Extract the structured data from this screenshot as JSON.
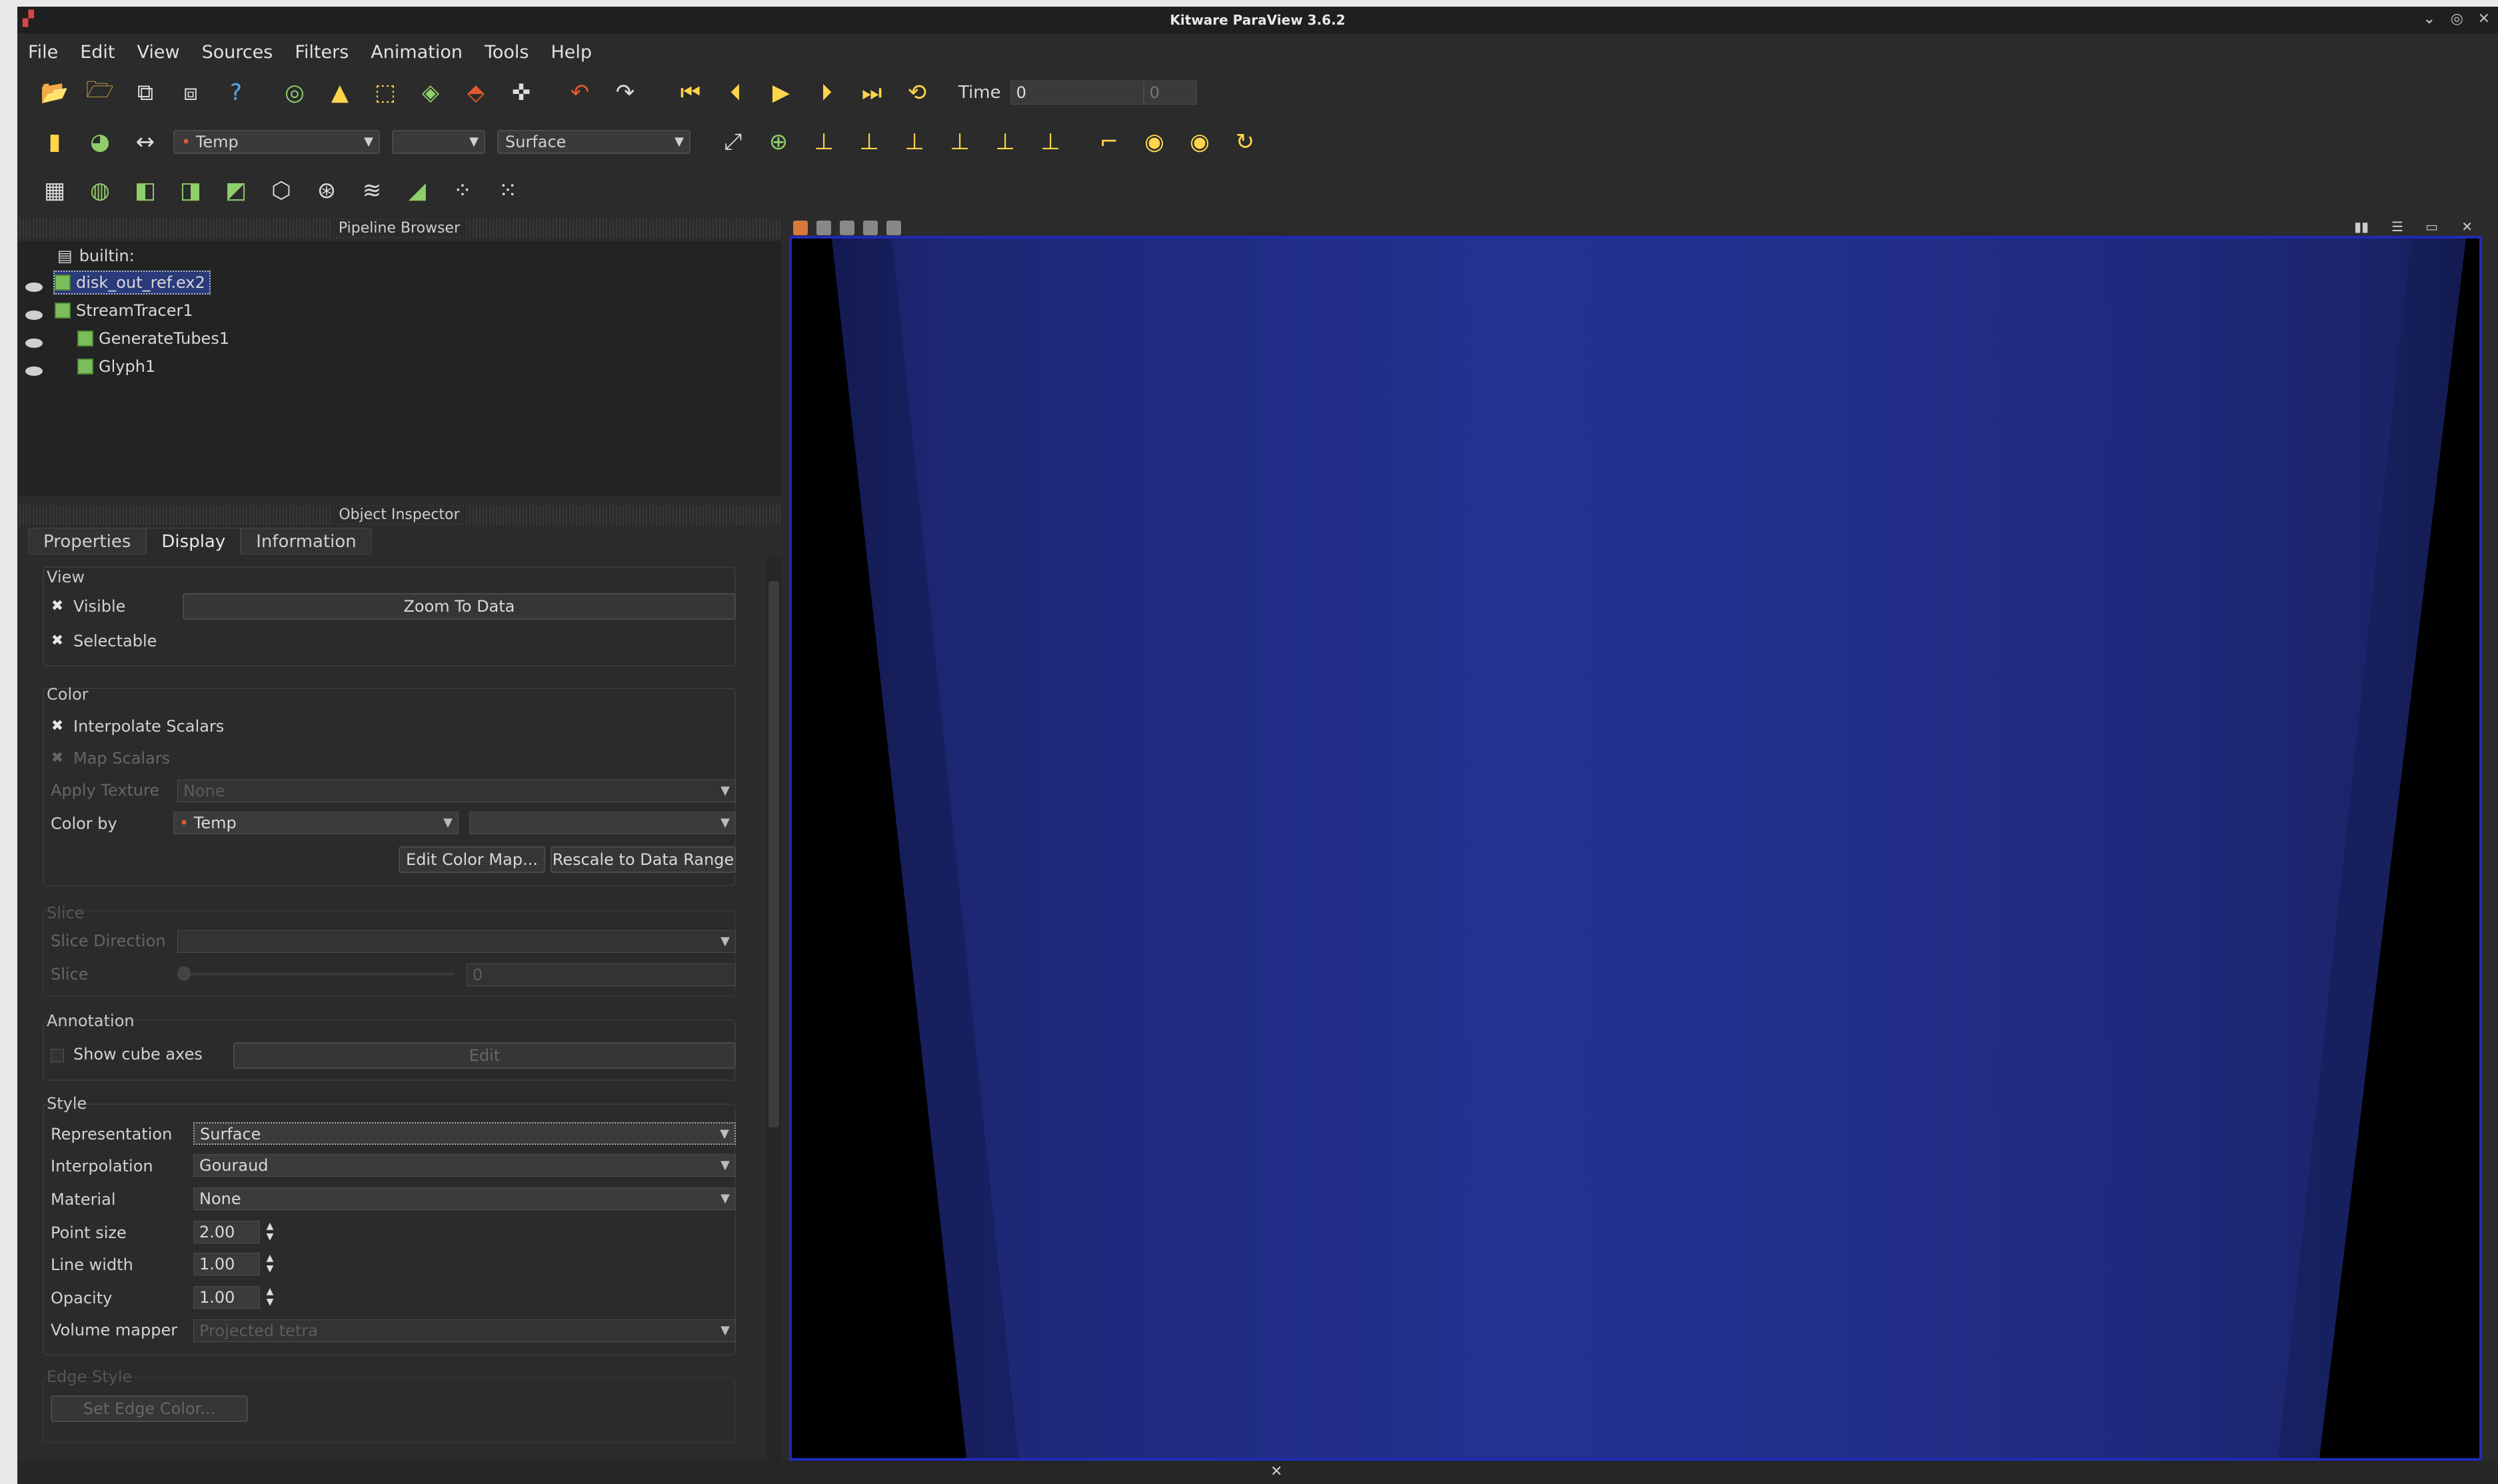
{
  "window": {
    "title": "Kitware ParaView 3.6.2"
  },
  "menu": [
    "File",
    "Edit",
    "View",
    "Sources",
    "Filters",
    "Animation",
    "Tools",
    "Help"
  ],
  "toolbar": {
    "time_label": "Time",
    "time_value": "0",
    "time_step": "0",
    "color_array": "Temp",
    "representation": "Surface"
  },
  "pipeline_browser": {
    "title": "Pipeline Browser",
    "items": [
      {
        "label": "builtin:",
        "selected": false,
        "visible": false
      },
      {
        "label": "disk_out_ref.ex2",
        "selected": true,
        "visible": true
      },
      {
        "label": "StreamTracer1",
        "selected": false,
        "visible": true
      },
      {
        "label": "GenerateTubes1",
        "selected": false,
        "visible": true
      },
      {
        "label": "Glyph1",
        "selected": false,
        "visible": true
      }
    ]
  },
  "object_inspector": {
    "title": "Object Inspector",
    "tabs": [
      "Properties",
      "Display",
      "Information"
    ],
    "active_tab": "Display",
    "view": {
      "title": "View",
      "visible": "Visible",
      "selectable": "Selectable",
      "zoom_to_data": "Zoom To Data"
    },
    "color": {
      "title": "Color",
      "interpolate_scalars": "Interpolate Scalars",
      "map_scalars": "Map Scalars",
      "apply_texture_label": "Apply Texture",
      "apply_texture_value": "None",
      "color_by_label": "Color by",
      "color_by_value": "Temp",
      "edit_color_map": "Edit Color Map...",
      "rescale": "Rescale to Data Range"
    },
    "slice": {
      "title": "Slice",
      "direction_label": "Slice Direction",
      "slice_label": "Slice",
      "slice_value": "0"
    },
    "annotation": {
      "title": "Annotation",
      "show_cube_axes": "Show cube axes",
      "edit": "Edit"
    },
    "style": {
      "title": "Style",
      "representation_label": "Representation",
      "representation_value": "Surface",
      "interpolation_label": "Interpolation",
      "interpolation_value": "Gouraud",
      "material_label": "Material",
      "material_value": "None",
      "point_size_label": "Point size",
      "point_size_value": "2.00",
      "line_width_label": "Line width",
      "line_width_value": "1.00",
      "opacity_label": "Opacity",
      "opacity_value": "1.00",
      "volume_mapper_label": "Volume mapper",
      "volume_mapper_value": "Projected tetra"
    },
    "edge_style": {
      "title": "Edge Style",
      "set_edge_color": "Set Edge Color..."
    }
  },
  "colors": {
    "background": "#2b2b2b",
    "render_bg": "#000000",
    "surface": "#1e2a80",
    "view_border": "#1f2ab8"
  }
}
